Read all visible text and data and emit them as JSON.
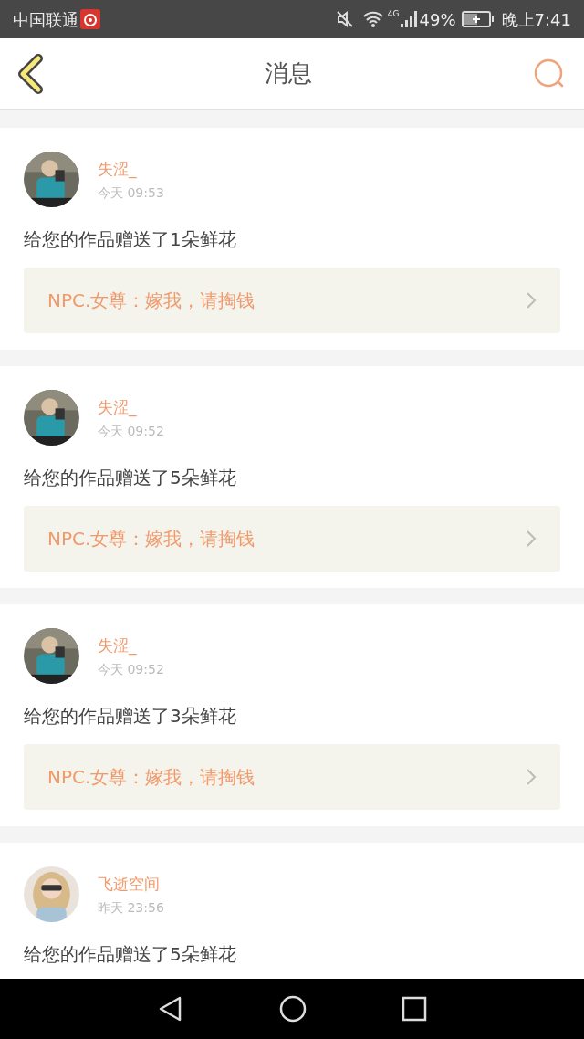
{
  "status_bar": {
    "carrier": "中国联通",
    "network": "4G",
    "battery": "49%",
    "time": "晚上7:41"
  },
  "header": {
    "title": "消息"
  },
  "messages": [
    {
      "name": "失涩_",
      "time": "今天 09:53",
      "text": "给您的作品赠送了1朵鲜花",
      "quote": "NPC.女尊：嫁我，请掏钱"
    },
    {
      "name": "失涩_",
      "time": "今天 09:52",
      "text": "给您的作品赠送了5朵鲜花",
      "quote": "NPC.女尊：嫁我，请掏钱"
    },
    {
      "name": "失涩_",
      "time": "今天 09:52",
      "text": "给您的作品赠送了3朵鲜花",
      "quote": "NPC.女尊：嫁我，请掏钱"
    },
    {
      "name": "飞逝空间",
      "time": "昨天 23:56",
      "text": "给您的作品赠送了5朵鲜花"
    }
  ]
}
